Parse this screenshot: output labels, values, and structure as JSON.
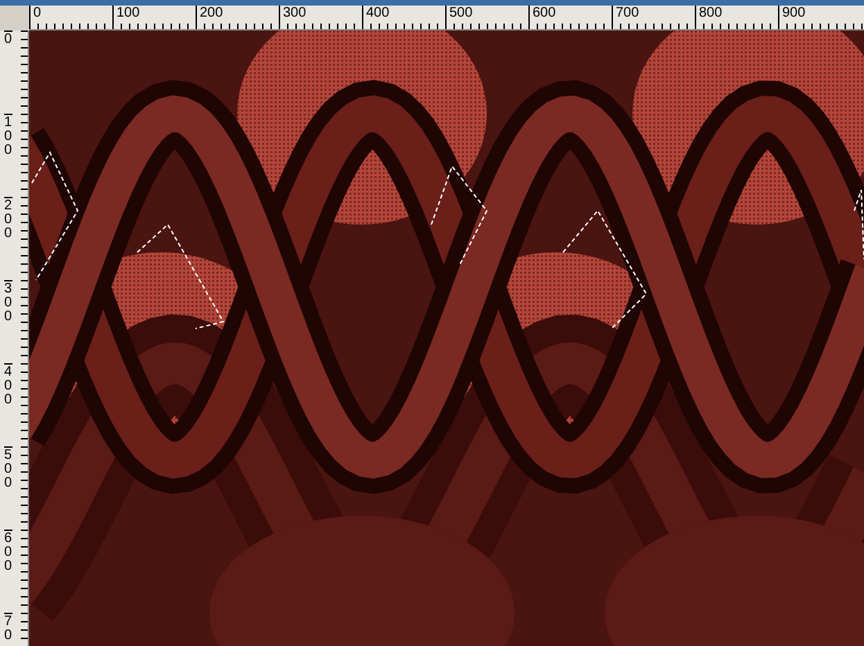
{
  "rulers": {
    "top_labels": [
      "0",
      "100",
      "200",
      "300",
      "400",
      "500",
      "600",
      "700",
      "800",
      "900"
    ],
    "left_labels": [
      "0",
      "100",
      "200",
      "300",
      "400",
      "500",
      "600",
      "70"
    ]
  }
}
